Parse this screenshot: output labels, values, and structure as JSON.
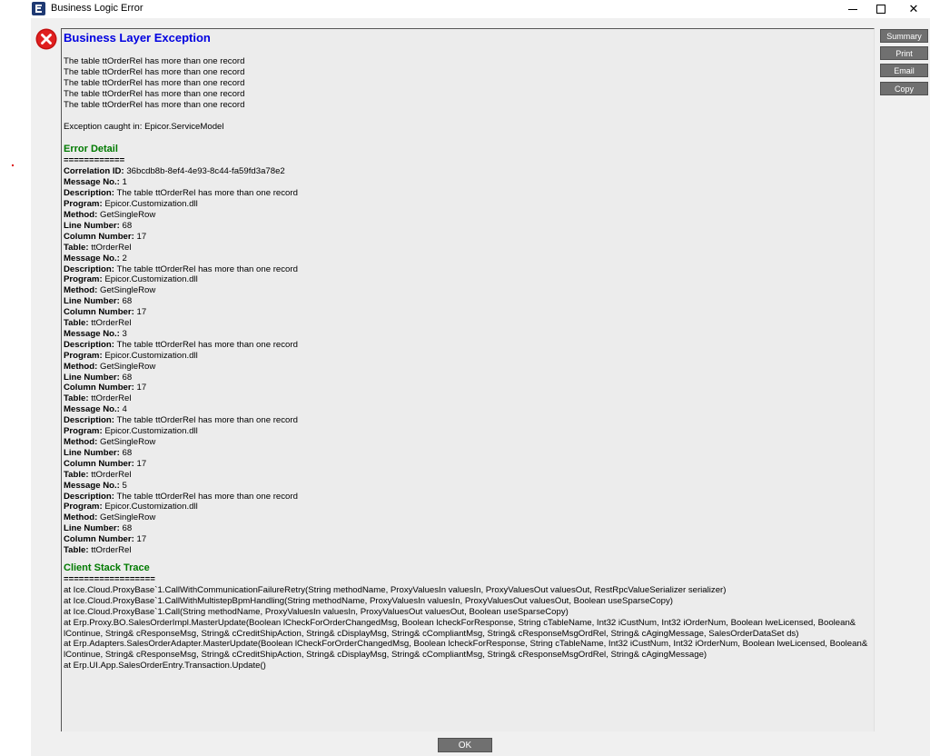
{
  "window": {
    "title": "Business Logic Error",
    "minimize_glyph": "",
    "maximize_glyph": "",
    "close_glyph": "✕"
  },
  "header": {
    "title": "Business Layer Exception"
  },
  "messages": [
    "The table ttOrderRel has more than one record",
    "The table ttOrderRel has more than one record",
    "The table ttOrderRel has more than one record",
    "The table ttOrderRel has more than one record",
    "The table ttOrderRel has more than one record"
  ],
  "exception_caught": "Exception caught in: Epicor.ServiceModel",
  "error_detail": {
    "heading": "Error Detail",
    "separator": "============",
    "correlation_label": "Correlation ID:",
    "correlation_value": "36bcdb8b-8ef4-4e93-8c44-fa59fd3a78e2",
    "labels": {
      "message_no": "Message No.:",
      "description": "Description:",
      "program": "Program:",
      "method": "Method:",
      "line_number": "Line Number:",
      "column_number": "Column Number:",
      "table": "Table:"
    },
    "entries": [
      {
        "message_no": "1",
        "description": "The table ttOrderRel has more than one record",
        "program": "Epicor.Customization.dll",
        "method": "GetSingleRow",
        "line_number": "68",
        "column_number": "17",
        "table": "ttOrderRel"
      },
      {
        "message_no": "2",
        "description": "The table ttOrderRel has more than one record",
        "program": "Epicor.Customization.dll",
        "method": "GetSingleRow",
        "line_number": "68",
        "column_number": "17",
        "table": "ttOrderRel"
      },
      {
        "message_no": "3",
        "description": "The table ttOrderRel has more than one record",
        "program": "Epicor.Customization.dll",
        "method": "GetSingleRow",
        "line_number": "68",
        "column_number": "17",
        "table": "ttOrderRel"
      },
      {
        "message_no": "4",
        "description": "The table ttOrderRel has more than one record",
        "program": "Epicor.Customization.dll",
        "method": "GetSingleRow",
        "line_number": "68",
        "column_number": "17",
        "table": "ttOrderRel"
      },
      {
        "message_no": "5",
        "description": "The table ttOrderRel has more than one record",
        "program": "Epicor.Customization.dll",
        "method": "GetSingleRow",
        "line_number": "68",
        "column_number": "17",
        "table": "ttOrderRel"
      }
    ]
  },
  "stack_trace": {
    "heading": "Client Stack Trace",
    "separator": "==================",
    "lines": [
      "   at Ice.Cloud.ProxyBase`1.CallWithCommunicationFailureRetry(String methodName, ProxyValuesIn valuesIn, ProxyValuesOut valuesOut, RestRpcValueSerializer serializer)",
      "   at Ice.Cloud.ProxyBase`1.CallWithMultistepBpmHandling(String methodName, ProxyValuesIn valuesIn, ProxyValuesOut valuesOut, Boolean useSparseCopy)",
      "   at Ice.Cloud.ProxyBase`1.Call(String methodName, ProxyValuesIn valuesIn, ProxyValuesOut valuesOut, Boolean useSparseCopy)",
      "   at Erp.Proxy.BO.SalesOrderImpl.MasterUpdate(Boolean lCheckForOrderChangedMsg, Boolean lcheckForResponse, String cTableName, Int32 iCustNum, Int32 iOrderNum, Boolean lweLicensed, Boolean& lContinue, String& cResponseMsg, String& cCreditShipAction, String& cDisplayMsg, String& cCompliantMsg, String& cResponseMsgOrdRel, String& cAgingMessage, SalesOrderDataSet ds)",
      "   at Erp.Adapters.SalesOrderAdapter.MasterUpdate(Boolean lCheckForOrderChangedMsg, Boolean lcheckForResponse, String cTableName, Int32 iCustNum, Int32 iOrderNum, Boolean lweLicensed, Boolean& lContinue, String& cResponseMsg, String& cCreditShipAction, String& cDisplayMsg, String& cCompliantMsg, String& cResponseMsgOrdRel, String& cAgingMessage)",
      "   at Erp.UI.App.SalesOrderEntry.Transaction.Update()"
    ]
  },
  "buttons": {
    "summary": "Summary",
    "print": "Print",
    "email": "Email",
    "copy": "Copy",
    "ok": "OK"
  },
  "colors": {
    "heading_blue": "#0000e0",
    "heading_green": "#007a00",
    "button_gray": "#707070",
    "error_red": "#e02020"
  }
}
